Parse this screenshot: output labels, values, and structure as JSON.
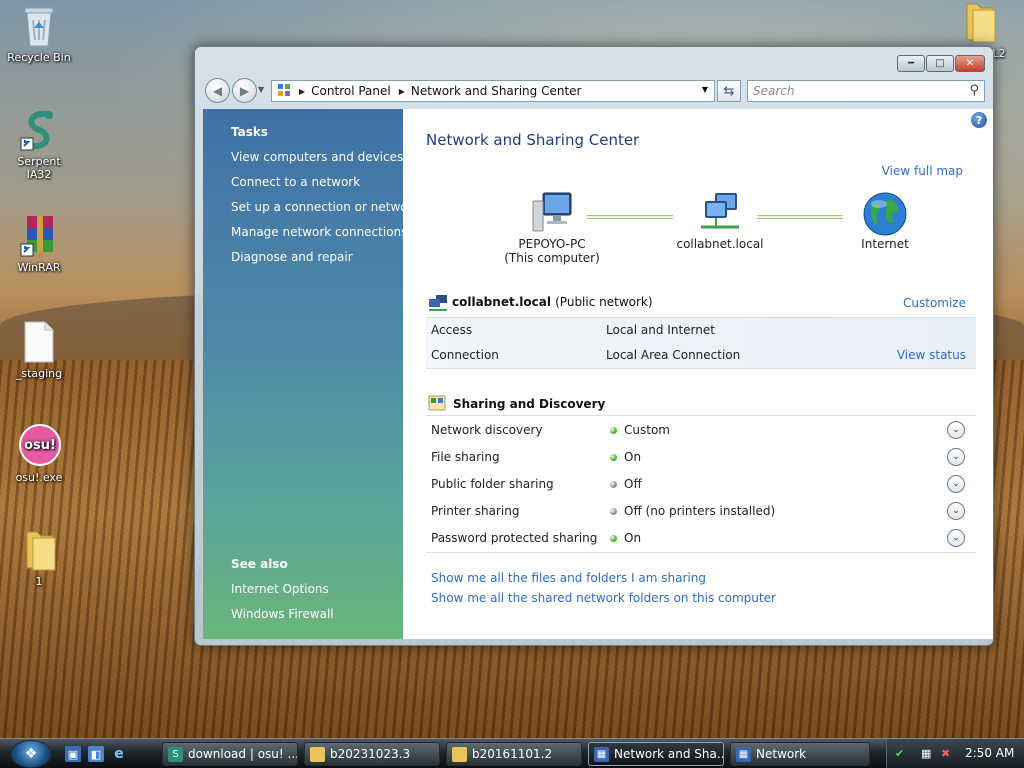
{
  "desktop": {
    "icons": [
      {
        "label": "Recycle Bin",
        "icon": "recycle-bin-icon"
      },
      {
        "label": "Serpent IA32",
        "icon": "serpent-icon"
      },
      {
        "label": "WinRAR",
        "icon": "winrar-icon"
      },
      {
        "label": "_staging",
        "icon": "file-icon"
      },
      {
        "label": "osu!.exe",
        "icon": "osu-icon"
      },
      {
        "label": "1",
        "icon": "folder-icon"
      },
      {
        "label": "L2",
        "icon": "folder-icon"
      }
    ],
    "osu_icon_text": "osu!"
  },
  "window": {
    "address": {
      "crumbs": [
        "Control Panel",
        "Network and Sharing Center"
      ]
    },
    "search_placeholder": "Search",
    "left_pane": {
      "tasks_heading": "Tasks",
      "tasks": [
        "View computers and devices",
        "Connect to a network",
        "Set up a connection or network",
        "Manage network connections",
        "Diagnose and repair"
      ],
      "see_also_heading": "See also",
      "see_also": [
        "Internet Options",
        "Windows Firewall"
      ]
    },
    "main": {
      "title": "Network and Sharing Center",
      "view_full_map": "View full map",
      "map_nodes": [
        {
          "line1": "PEPOYO-PC",
          "line2": "(This computer)",
          "icon": "computer-icon"
        },
        {
          "line1": "collabnet.local",
          "line2": "",
          "icon": "network-icon"
        },
        {
          "line1": "Internet",
          "line2": "",
          "icon": "globe-icon"
        }
      ],
      "network": {
        "name": "collabnet.local",
        "type": "(Public network)",
        "customize": "Customize",
        "rows": [
          {
            "key": "Access",
            "value": "Local and Internet",
            "action": ""
          },
          {
            "key": "Connection",
            "value": "Local Area Connection",
            "action": "View status"
          }
        ]
      },
      "sharing": {
        "heading": "Sharing and Discovery",
        "rows": [
          {
            "key": "Network discovery",
            "value": "Custom",
            "status_color": "#4fb32b"
          },
          {
            "key": "File sharing",
            "value": "On",
            "status_color": "#4fb32b"
          },
          {
            "key": "Public folder sharing",
            "value": "Off",
            "status_color": "#8c8c8c"
          },
          {
            "key": "Printer sharing",
            "value": "Off (no printers installed)",
            "status_color": "#8c8c8c"
          },
          {
            "key": "Password protected sharing",
            "value": "On",
            "status_color": "#4fb32b"
          }
        ]
      },
      "bottom_links": [
        "Show me all the files and folders I am sharing",
        "Show me all the shared network folders on this computer"
      ]
    }
  },
  "taskbar": {
    "buttons": [
      {
        "label": "download | osu! ...",
        "icon": "serpent-icon"
      },
      {
        "label": "b20231023.3",
        "icon": "folder-icon"
      },
      {
        "label": "b20161101.2",
        "icon": "folder-icon"
      },
      {
        "label": "Network and Sha...",
        "icon": "network-center-icon",
        "active": true
      },
      {
        "label": "Network",
        "icon": "network-icon"
      }
    ],
    "clock": "2:50 AM"
  }
}
